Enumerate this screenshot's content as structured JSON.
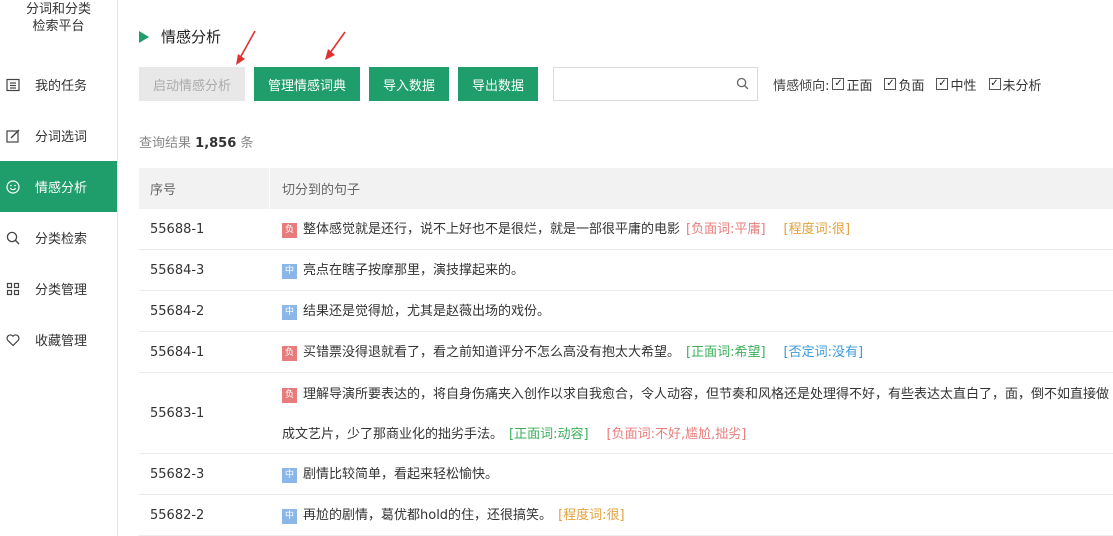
{
  "brand": {
    "line1": "分词和分类",
    "line2": "检索平台"
  },
  "nav": [
    {
      "label": "我的任务",
      "icon": "list-icon"
    },
    {
      "label": "分词选词",
      "icon": "edit-icon"
    },
    {
      "label": "情感分析",
      "icon": "smile-icon",
      "active": true
    },
    {
      "label": "分类检索",
      "icon": "search-icon"
    },
    {
      "label": "分类管理",
      "icon": "grid-icon"
    },
    {
      "label": "收藏管理",
      "icon": "heart-icon"
    }
  ],
  "page_title": "情感分析",
  "toolbar": {
    "start_label": "启动情感分析",
    "manage_label": "管理情感词典",
    "import_label": "导入数据",
    "export_label": "导出数据",
    "search_placeholder": "",
    "filter_label": "情感倾向:",
    "filters": [
      {
        "label": "正面",
        "checked": true
      },
      {
        "label": "负面",
        "checked": true
      },
      {
        "label": "中性",
        "checked": true
      },
      {
        "label": "未分析",
        "checked": true
      }
    ]
  },
  "result": {
    "prefix": "查询结果",
    "count": "1,856",
    "suffix": "条"
  },
  "table": {
    "headers": [
      "序号",
      "切分到的句子"
    ],
    "rows": [
      {
        "id": "55688-1",
        "tag": "负",
        "text": "整体感觉就是还行，说不上好也不是很烂，就是一部很平庸的电影",
        "anns": [
          {
            "t": "[负面词:平庸]",
            "c": "red"
          },
          {
            "t": "[程度词:很]",
            "c": "orange"
          }
        ]
      },
      {
        "id": "55684-3",
        "tag": "中",
        "text": "亮点在瞎子按摩那里，演技撑起来的。",
        "anns": []
      },
      {
        "id": "55684-2",
        "tag": "中",
        "text": "结果还是觉得尬，尤其是赵薇出场的戏份。",
        "anns": []
      },
      {
        "id": "55684-1",
        "tag": "负",
        "text": "买错票没得退就看了，看之前知道评分不怎么高没有抱太大希望。",
        "anns": [
          {
            "t": "[正面词:希望]",
            "c": "green"
          },
          {
            "t": "[否定词:没有]",
            "c": "blue"
          }
        ]
      },
      {
        "id": "55683-1",
        "tag": "负",
        "text": "理解导演所要表达的，将自身伤痛夹入创作以求自我愈合，令人动容，但节奏和风格还是处理得不好，有些表达太直白了，面，倒不如直接做成文艺片，少了那商业化的拙劣手法。",
        "anns": [
          {
            "t": "[正面词:动容]",
            "c": "green"
          },
          {
            "t": "[负面词:不好,尴尬,拙劣]",
            "c": "red"
          }
        ]
      },
      {
        "id": "55682-3",
        "tag": "中",
        "text": "剧情比较简单，看起来轻松愉快。",
        "anns": []
      },
      {
        "id": "55682-2",
        "tag": "中",
        "text": "再尬的剧情，葛优都hold的住，还很搞笑。",
        "anns": [
          {
            "t": "[程度词:很]",
            "c": "orange"
          }
        ]
      }
    ]
  },
  "colors": {
    "accent": "#1f9d6a",
    "negative_tag": "#e87c7c",
    "neutral_tag": "#8ab7e8",
    "arrow": "#e03030"
  }
}
